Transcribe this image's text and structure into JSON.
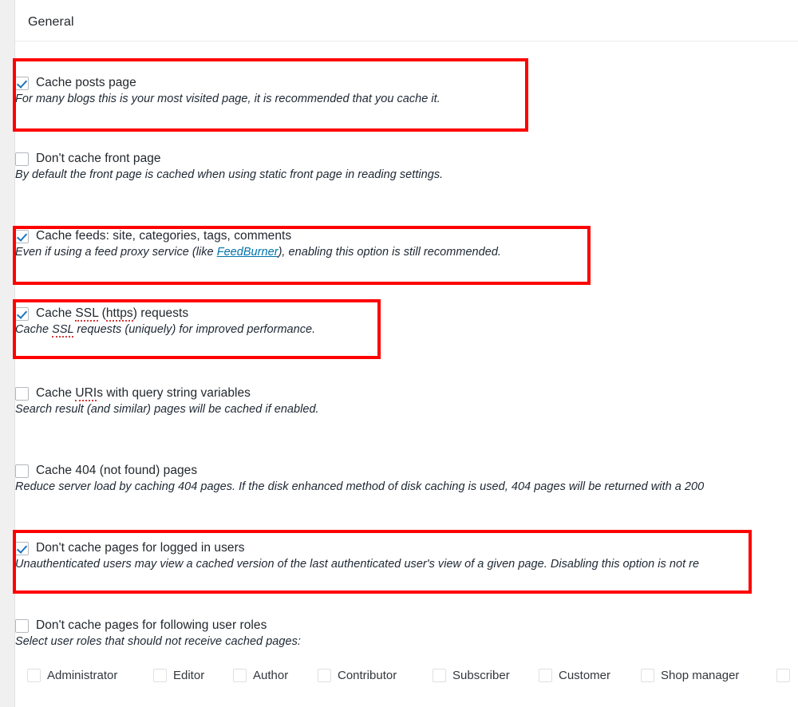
{
  "panel": {
    "title": "General"
  },
  "options": [
    {
      "id": "cache-posts-page",
      "label": "Cache posts page",
      "description": "For many blogs this is your most visited page, it is recommended that you cache it.",
      "checked": true,
      "highlighted": true
    },
    {
      "id": "dont-cache-front-page",
      "label": "Don't cache front page",
      "description": "By default the front page is cached when using static front page in reading settings.",
      "checked": false,
      "highlighted": false
    },
    {
      "id": "cache-feeds",
      "label": "Cache feeds: site, categories, tags, comments",
      "description_pre": "Even if using a feed proxy service (like ",
      "description_link": "FeedBurner",
      "description_post": "), enabling this option is still recommended.",
      "checked": true,
      "highlighted": true
    },
    {
      "id": "cache-ssl-requests",
      "label_pre": "Cache ",
      "label_spell_1": "SSL",
      "label_mid": " (",
      "label_spell_2": "https",
      "label_post": ") requests",
      "description_pre": "Cache ",
      "description_spell": "SSL",
      "description_post": " requests (uniquely) for improved performance.",
      "checked": true,
      "highlighted": true
    },
    {
      "id": "cache-uris-query-string",
      "label_pre": "Cache ",
      "label_spell": "URI",
      "label_post": "s with query string variables",
      "description": "Search result (and similar) pages will be cached if enabled.",
      "checked": false,
      "highlighted": false
    },
    {
      "id": "cache-404-pages",
      "label": "Cache 404 (not found) pages",
      "description": "Reduce server load by caching 404 pages. If the disk enhanced method of disk caching is used, 404 pages will be returned with a 200",
      "checked": false,
      "highlighted": false
    },
    {
      "id": "dont-cache-logged-in",
      "label": "Don't cache pages for logged in users",
      "description": "Unauthenticated users may view a cached version of the last authenticated user's view of a given page. Disabling this option is not re",
      "checked": true,
      "highlighted": true
    },
    {
      "id": "dont-cache-user-roles",
      "label": "Don't cache pages for following user roles",
      "description": "Select user roles that should not receive cached pages:",
      "checked": false,
      "highlighted": false
    }
  ],
  "user_roles": [
    {
      "label": "Administrator",
      "checked": false
    },
    {
      "label": "Editor",
      "checked": false
    },
    {
      "label": "Author",
      "checked": false
    },
    {
      "label": "Contributor",
      "checked": false
    },
    {
      "label": "Subscriber",
      "checked": false
    },
    {
      "label": "Customer",
      "checked": false
    },
    {
      "label": "Shop manager",
      "checked": false
    },
    {
      "label": "",
      "checked": false
    }
  ],
  "colors": {
    "highlight": "#fe0000",
    "checkmark": "#1e73be",
    "link": "#0073aa",
    "text": "#23282d",
    "page_background": "#f0f0f0",
    "panel_background": "#ffffff",
    "spellcheck_underline": "#d53a3a"
  }
}
